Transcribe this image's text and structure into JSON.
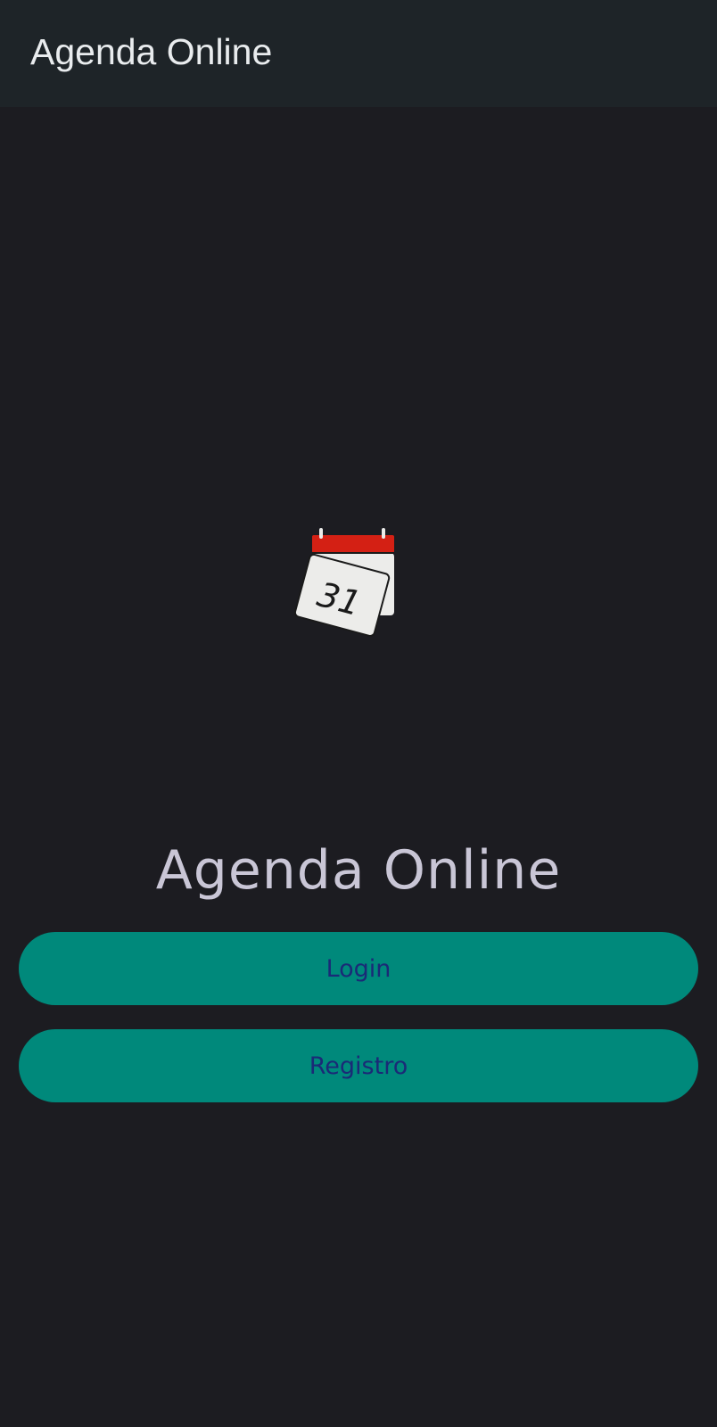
{
  "app_bar": {
    "title": "Agenda Online"
  },
  "logo": {
    "icon": "calendar-icon",
    "day": "31",
    "colors": {
      "binding": "#d42014",
      "page": "#ececea",
      "ink": "#1a1a1a"
    }
  },
  "hero": {
    "title": "Agenda Online"
  },
  "buttons": {
    "login_label": "Login",
    "register_label": "Registro"
  },
  "colors": {
    "background": "#1c1c21",
    "app_bar": "#1e2428",
    "button": "#00897b",
    "button_text": "#1a2a77",
    "hero_text": "#c9c6d6"
  }
}
